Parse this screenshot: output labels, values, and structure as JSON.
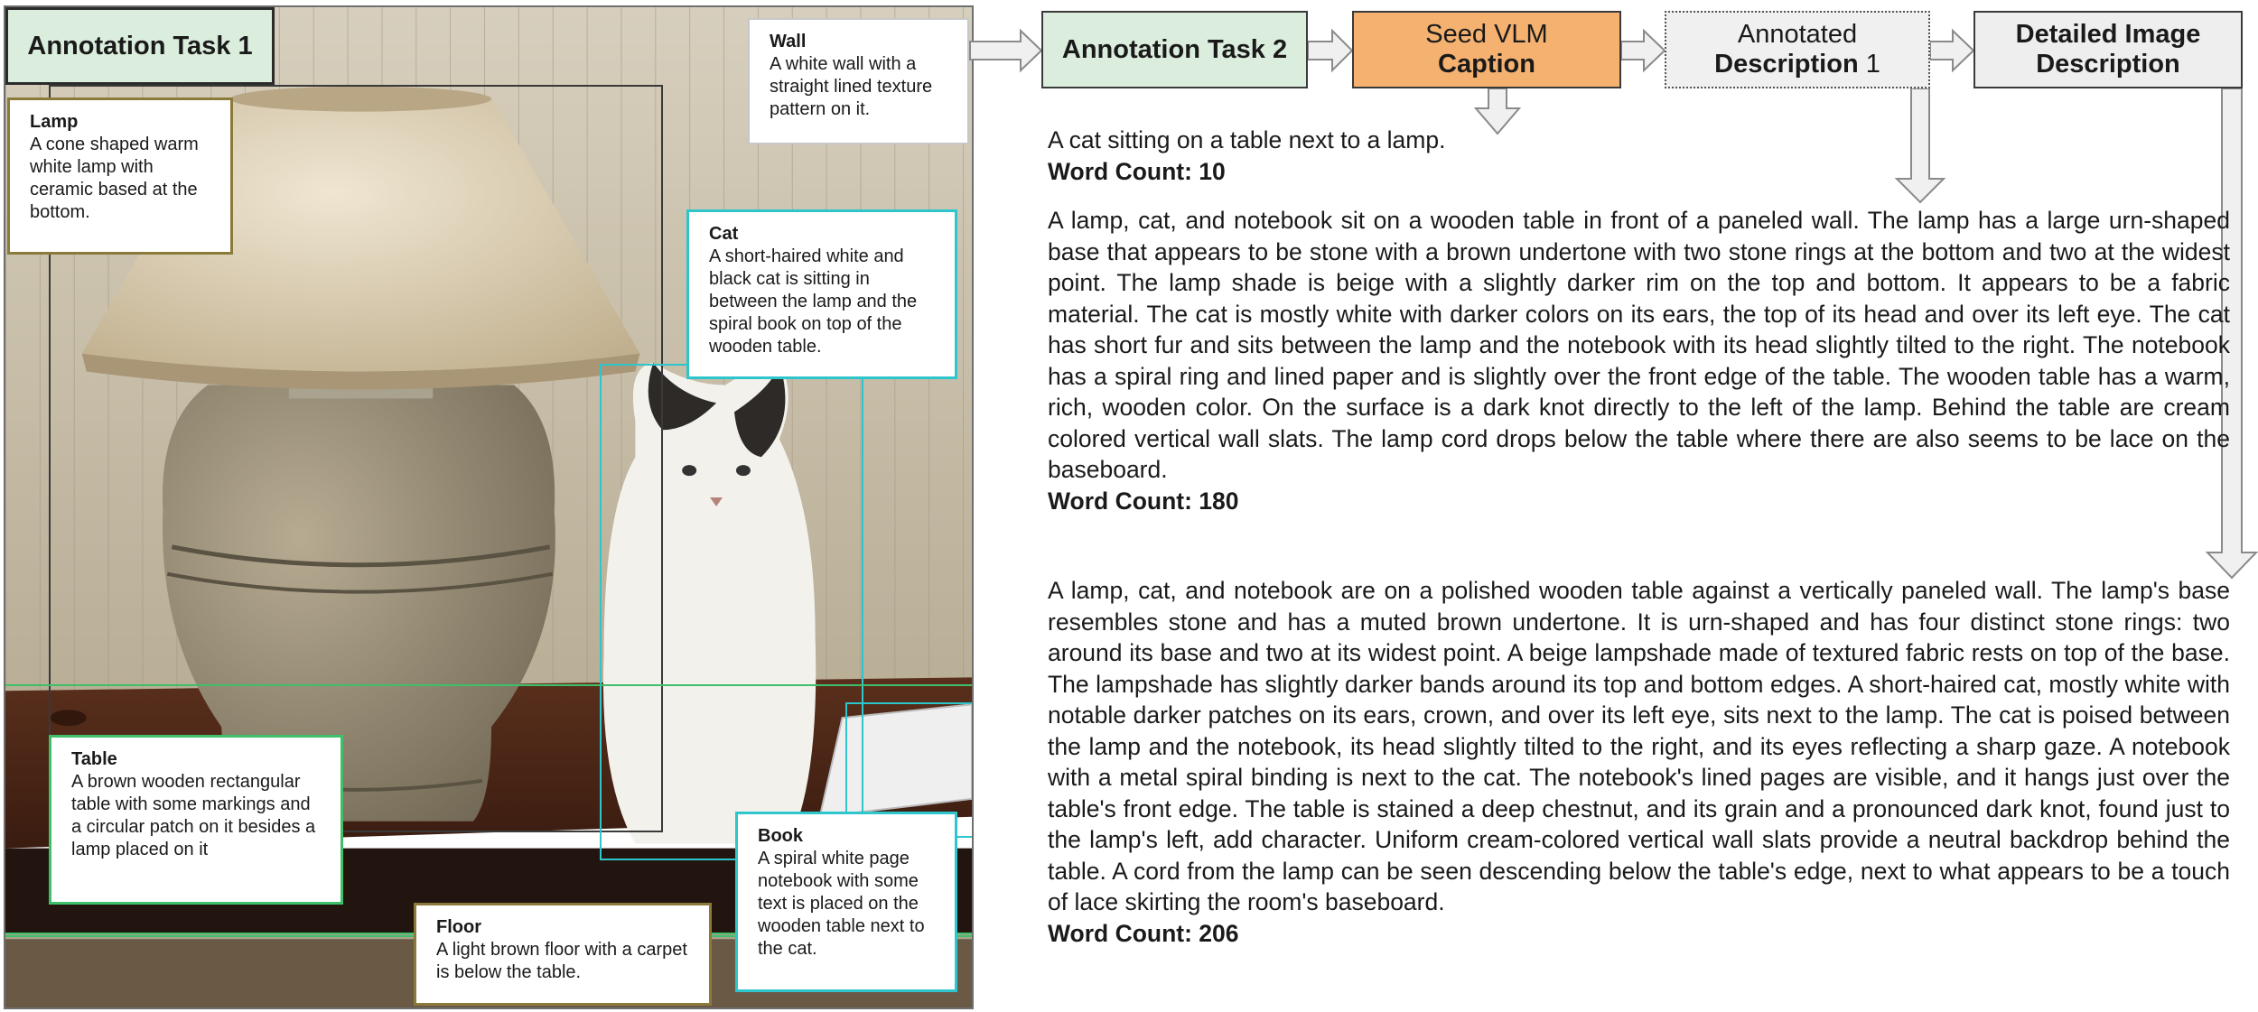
{
  "photo": {
    "task_label": "Annotation Task 1",
    "annotations": {
      "lamp": {
        "title": "Lamp",
        "text": "A cone shaped warm white lamp with ceramic based at the bottom."
      },
      "wall": {
        "title": "Wall",
        "text": "A white wall with a straight lined texture pattern on it."
      },
      "cat": {
        "title": "Cat",
        "text": "A short-haired white and black cat is sitting in between the lamp and the spiral book on top of the wooden table."
      },
      "table": {
        "title": "Table",
        "text": "A brown wooden rectangular table with some markings and a circular patch on it besides a lamp placed on it"
      },
      "book": {
        "title": "Book",
        "text": "A spiral white page notebook with some text is placed on the wooden table next to the cat."
      },
      "floor": {
        "title": "Floor",
        "text": "A light brown floor with a carpet is below the table."
      }
    }
  },
  "flow": {
    "task2": "Annotation Task 2",
    "seed_line1": "Seed VLM",
    "seed_line2": "Caption",
    "annotated_line1": "Annotated",
    "annotated_line2_bold": "Description",
    "annotated_line2_num": " 1",
    "detailed_line1": "Detailed Image",
    "detailed_line2": "Description"
  },
  "caption": {
    "text": "A cat sitting on a table next to a lamp.",
    "word_count": "Word Count: 10"
  },
  "annotated_description": {
    "text": "A lamp, cat, and notebook sit on a wooden table in front of a paneled wall. The lamp has a large urn-shaped base that appears to be stone with a brown undertone with two stone rings at the bottom and two at the widest point. The lamp shade is beige with a slightly darker rim on the top and bottom. It appears to be a fabric material. The cat is mostly white with darker colors on its ears, the top of its head and over its left eye. The cat has short fur and sits between the lamp and the notebook with its head slightly tilted to the right. The notebook has a spiral ring and lined paper and is slightly over the front edge of the table. The wooden table has a warm, rich, wooden color. On the surface is a dark knot directly to the left of the lamp. Behind the table are cream colored vertical wall slats. The lamp cord drops below the table where there are also seems to be lace on the baseboard.",
    "word_count": "Word Count: 180"
  },
  "detailed_description": {
    "text": "A lamp, cat, and notebook are on a polished wooden table against a vertically paneled wall. The lamp's base resembles stone and has a muted brown undertone. It is urn-shaped and has four distinct stone rings: two around its base and two at its widest point. A beige lampshade made of textured fabric rests on top of the base. The lampshade has slightly darker bands around its top and bottom edges. A short-haired cat, mostly white with notable darker patches on its ears, crown, and over its left eye, sits next to the lamp. The cat is poised between the lamp and the notebook, its head slightly tilted to the right, and its eyes reflecting a sharp gaze. A notebook with a metal spiral binding is next to the cat. The notebook's lined pages are visible, and it hangs just over the table's front edge. The table is stained a deep chestnut, and its grain and a pronounced dark knot, found just to the lamp's left, add character. Uniform cream-colored vertical wall slats provide a neutral backdrop behind the table. A cord from the lamp can be seen descending below the table's edge, next to what appears to be a touch of lace skirting the room's baseboard.",
    "word_count": "Word Count: 206"
  },
  "colors": {
    "task_green": "#dbeedd",
    "seed_orange": "#f5b170",
    "bbox_cyan": "#2ec6cc",
    "bbox_green": "#3fbf6a",
    "bbox_dark": "#3a3a3a"
  }
}
